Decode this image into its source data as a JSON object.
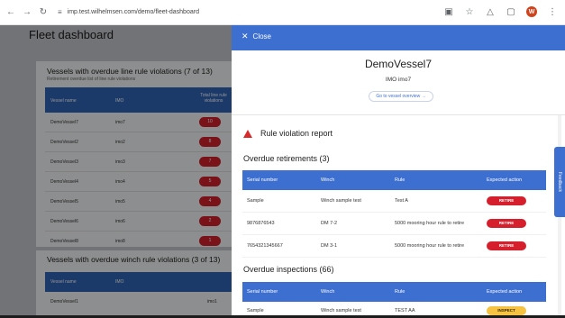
{
  "browser": {
    "url": "imp.test.wilhelmsen.com/demo/fleet-dashboard",
    "avatar_letter": "W"
  },
  "background": {
    "title": "Fleet dashboard",
    "card1": {
      "title": "Vessels with overdue line rule violations (7 of 13)",
      "subtitle": "Retirement overdue list of line rule violations",
      "columns": [
        "Vessel name",
        "IMO",
        "Total line rule violations"
      ],
      "rows": [
        {
          "name": "DemoVessel7",
          "imo": "imo7",
          "count": "10"
        },
        {
          "name": "DemoVessel2",
          "imo": "imo2",
          "count": "8"
        },
        {
          "name": "DemoVessel3",
          "imo": "imo3",
          "count": "7"
        },
        {
          "name": "DemoVessel4",
          "imo": "imo4",
          "count": "5"
        },
        {
          "name": "DemoVessel5",
          "imo": "imo5",
          "count": "4"
        },
        {
          "name": "DemoVessel6",
          "imo": "imo6",
          "count": "2"
        },
        {
          "name": "DemoVessel8",
          "imo": "imo8",
          "count": "1"
        }
      ]
    },
    "card2": {
      "title": "Vessels with overdue winch rule violations (3 of 13)",
      "columns": [
        "Vessel name",
        "IMO"
      ],
      "row": {
        "name": "DemoVessel1",
        "imo": "imo1"
      }
    }
  },
  "drawer": {
    "close_label": "Close",
    "vessel_name": "DemoVessel7",
    "imo_label": "IMO imo7",
    "goto_label": "Go to vessel overview →",
    "report_title": "Rule violation report",
    "retirements": {
      "title": "Overdue retirements (3)",
      "columns": [
        "Serial number",
        "Winch",
        "Rule",
        "Expected action"
      ],
      "rows": [
        {
          "serial": "Sample",
          "winch": "Winch sample test",
          "rule": "Test A",
          "action": "RETIRE"
        },
        {
          "serial": "9876876543",
          "winch": "DM 7-2",
          "rule": "5000 mooring hour rule to retire",
          "action": "RETIRE"
        },
        {
          "serial": "7654321345667",
          "winch": "DM 3-1",
          "rule": "5000 mooring hour rule to retire",
          "action": "RETIRE"
        }
      ]
    },
    "inspections": {
      "title": "Overdue inspections (66)",
      "columns": [
        "Serial number",
        "Winch",
        "Rule",
        "Expected action"
      ],
      "rows": [
        {
          "serial": "Sample",
          "winch": "Winch sample test",
          "rule": "TEST AA",
          "action": "INSPECT"
        }
      ]
    }
  },
  "feedback_label": "Feedback",
  "colors": {
    "accent": "#3d6fd1",
    "retire": "#d61f2c",
    "inspect": "#f5c242"
  }
}
